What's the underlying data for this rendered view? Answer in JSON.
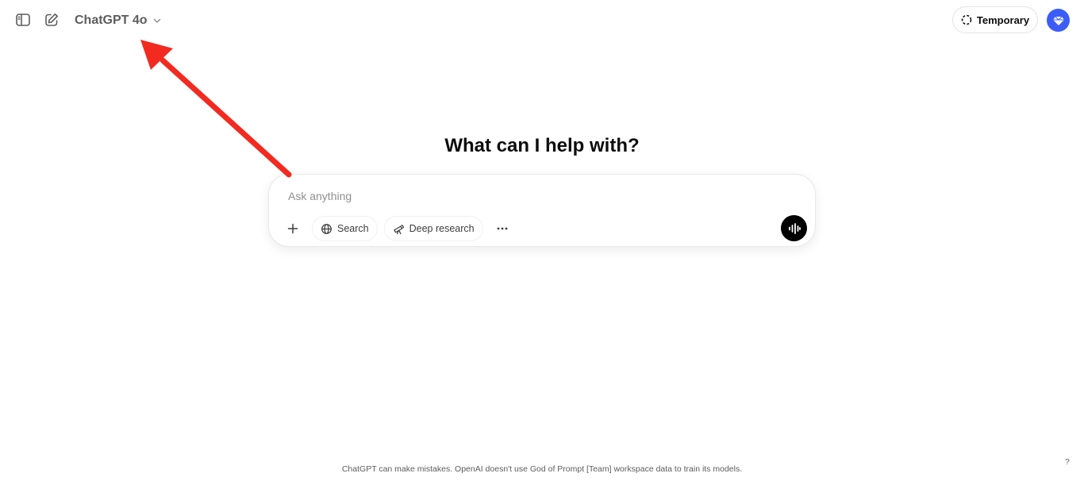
{
  "header": {
    "model_name": "ChatGPT 4o",
    "temporary_label": "Temporary"
  },
  "main": {
    "headline": "What can I help with?",
    "composer": {
      "placeholder": "Ask anything",
      "search_label": "Search",
      "deep_research_label": "Deep research"
    }
  },
  "footer": {
    "disclaimer": "ChatGPT can make mistakes. OpenAI doesn't use God of Prompt [Team] workspace data to train its models.",
    "help_label": "?"
  },
  "icons": {
    "sidebar": "sidebar-toggle-icon",
    "new_chat": "edit-icon",
    "model_chevron": "chevron-down-icon",
    "temporary": "dashed-circle-icon",
    "avatar": "diamond-icon",
    "add": "plus-icon",
    "search": "globe-icon",
    "deep_research": "telescope-icon",
    "more": "more-dots-icon",
    "voice": "voice-wave-icon"
  },
  "colors": {
    "avatar_bg": "#3b5cf6",
    "voice_bg": "#000000",
    "annotation_arrow": "#f32a1f"
  }
}
